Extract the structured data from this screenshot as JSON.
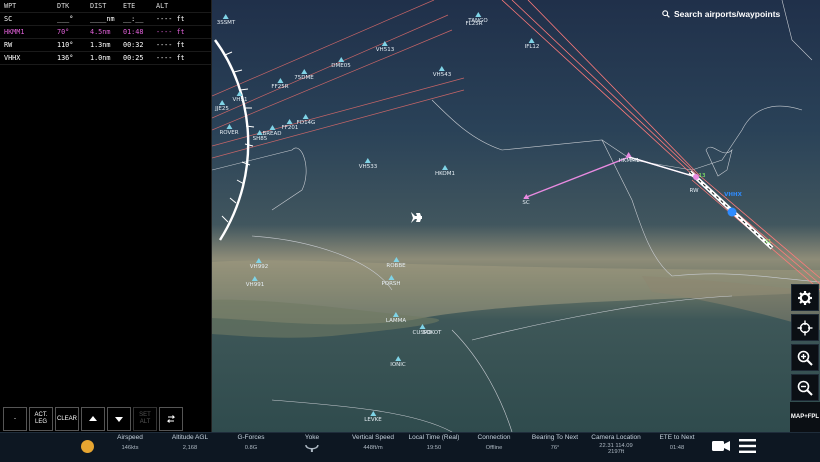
{
  "flight_plan": {
    "headers": {
      "wpt": "WPT",
      "dtk": "DTK",
      "dist": "DIST",
      "ete": "ETE",
      "alt": "ALT"
    },
    "rows": [
      {
        "wpt": "SC",
        "dtk": "___°",
        "dist": "____nm",
        "ete": "__:__",
        "alt": "---- ft",
        "active": false
      },
      {
        "wpt": "HKMM1",
        "dtk": "70°",
        "dist": "4.5nm",
        "ete": "01:48",
        "alt": "---- ft",
        "active": true
      },
      {
        "wpt": "RW",
        "dtk": "110°",
        "dist": "1.3nm",
        "ete": "00:32",
        "alt": "---- ft",
        "active": false
      },
      {
        "wpt": "VHHX",
        "dtk": "136°",
        "dist": "1.0nm",
        "ete": "00:25",
        "alt": "---- ft",
        "active": false
      }
    ],
    "controls": {
      "dash": "-",
      "act_leg": "ACT. LEG",
      "clear": "CLEAR",
      "up": "up-arrow-icon",
      "down": "down-arrow-icon",
      "set_alt": "SET ALT",
      "reverse": "reverse-icon"
    }
  },
  "search": {
    "label": "Search airports/waypoints"
  },
  "map_buttons": {
    "settings": "gear-icon",
    "center": "center-crosshair-icon",
    "zoom_in": "zoom-in-icon",
    "zoom_out": "zoom-out-icon",
    "map_fpl": "MAP+FPL"
  },
  "waypoints": [
    {
      "name": "3SSMT"
    },
    {
      "name": "FL25R"
    },
    {
      "name": "TANGO"
    },
    {
      "name": "IFL12"
    },
    {
      "name": "VH513"
    },
    {
      "name": "VH543"
    },
    {
      "name": "DME05"
    },
    {
      "name": "75DME"
    },
    {
      "name": "FF25R"
    },
    {
      "name": "VH51"
    },
    {
      "name": "JJE25"
    },
    {
      "name": "ROVER"
    },
    {
      "name": "SH85"
    },
    {
      "name": "SHOD"
    },
    {
      "name": "BREAD"
    },
    {
      "name": "FF20"
    },
    {
      "name": "ROC"
    },
    {
      "name": "GOB1"
    },
    {
      "name": "SMG"
    },
    {
      "name": "BL"
    },
    {
      "name": "FF201"
    },
    {
      "name": "FD14G"
    },
    {
      "name": "VH533"
    },
    {
      "name": "HKOM1"
    },
    {
      "name": "HKMM1"
    },
    {
      "name": "SC"
    },
    {
      "name": "RW"
    },
    {
      "name": "VHHX"
    },
    {
      "name": "VH992"
    },
    {
      "name": "VH991"
    },
    {
      "name": "ROBBE"
    },
    {
      "name": "PORSH"
    },
    {
      "name": "LAMMA"
    },
    {
      "name": "CUSPO"
    },
    {
      "name": "SOKOT"
    },
    {
      "name": "IONIC"
    },
    {
      "name": "LEVKE"
    },
    {
      "name": "13"
    },
    {
      "name": "31"
    }
  ],
  "status_bar": {
    "airspeed": {
      "label": "Airspeed",
      "value": "146kts"
    },
    "altitude": {
      "label": "Altitude AGL",
      "value": "2,168"
    },
    "gforces": {
      "label": "G-Forces",
      "value": "0.8G"
    },
    "yoke": {
      "label": "Yoke",
      "value": ""
    },
    "vspeed": {
      "label": "Vertical Speed",
      "value": "448ft/m"
    },
    "localtime": {
      "label": "Local Time (Real)",
      "value": "19:50"
    },
    "connection": {
      "label": "Connection",
      "value": "Offline"
    },
    "bearing": {
      "label": "Bearing To Next",
      "value": "76°"
    },
    "camera": {
      "label": "Camera Location",
      "value": "22.31 114.09",
      "value2": "2197ft"
    },
    "ete_next": {
      "label": "ETE to Next",
      "value": "01:48"
    }
  },
  "colors": {
    "route_active": "#e88ae0",
    "route_white": "#ffffff",
    "waypoint": "#7fd3e6",
    "runway_approach": "#ff6b6b",
    "aircraft_blue": "#2f8cff"
  }
}
